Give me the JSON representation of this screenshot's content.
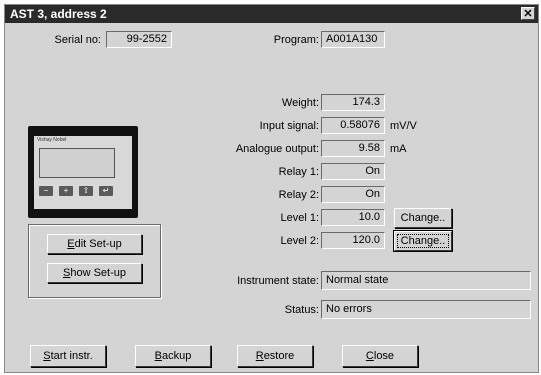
{
  "window": {
    "title": "AST 3, address 2",
    "close_glyph": "✕"
  },
  "header": {
    "serial_label": "Serial no:",
    "serial_value": "99-2552",
    "program_label": "Program:",
    "program_value": "A001A130"
  },
  "readings": [
    {
      "key": "weight",
      "label": "Weight:",
      "value": "174.3",
      "unit": ""
    },
    {
      "key": "input-signal",
      "label": "Input signal:",
      "value": "0.58076",
      "unit": "mV/V"
    },
    {
      "key": "analogue-output",
      "label": "Analogue output:",
      "value": "9.58",
      "unit": "mA"
    },
    {
      "key": "relay-1",
      "label": "Relay 1:",
      "value": "On",
      "unit": ""
    },
    {
      "key": "relay-2",
      "label": "Relay 2:",
      "value": "On",
      "unit": ""
    },
    {
      "key": "level-1",
      "label": "Level 1:",
      "value": "10.0",
      "unit": ""
    },
    {
      "key": "level-2",
      "label": "Level 2:",
      "value": "120.0",
      "unit": ""
    }
  ],
  "change_label": "Change..",
  "instrument_state_label": "Instrument state:",
  "instrument_state_value": "Normal state",
  "status_label": "Status:",
  "status_value": "No errors",
  "setup": {
    "edit_key": "E",
    "edit_rest": "dit Set-up",
    "show_key": "S",
    "show_rest": "how Set-up"
  },
  "device": {
    "brand": "Vishay Nobel",
    "keys": [
      "−",
      "+",
      "⇧",
      "↵"
    ]
  },
  "footer": {
    "start_key": "S",
    "start_rest": "tart instr.",
    "backup_key": "B",
    "backup_rest": "ackup",
    "restore_key": "R",
    "restore_rest": "estore",
    "close_key": "C",
    "close_rest": "lose"
  }
}
